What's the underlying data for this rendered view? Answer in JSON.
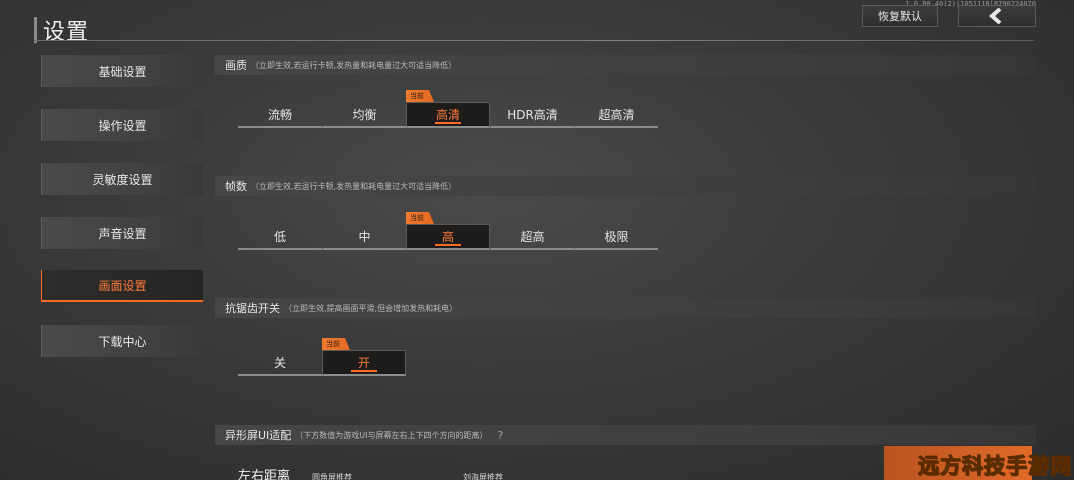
{
  "version": "1.0.80.40(2)|1051118|8790224070",
  "header": {
    "title": "设置",
    "reset_label": "恢复默认",
    "back_icon": "back-arrow-icon"
  },
  "sidebar": {
    "items": [
      {
        "label": "基础设置",
        "active": false
      },
      {
        "label": "操作设置",
        "active": false
      },
      {
        "label": "灵敏度设置",
        "active": false
      },
      {
        "label": "声音设置",
        "active": false
      },
      {
        "label": "画面设置",
        "active": true
      },
      {
        "label": "下载中心",
        "active": false
      }
    ]
  },
  "current_tag": "当前",
  "sections": {
    "quality": {
      "title": "画质",
      "subtitle": "（立即生效,若运行卡顿,发热量和耗电量过大可适当降低）",
      "options": [
        "流畅",
        "均衡",
        "高清",
        "HDR高清",
        "超高清"
      ],
      "selected": "高清"
    },
    "framerate": {
      "title": "帧数",
      "subtitle": "（立即生效,若运行卡顿,发热量和耗电量过大可适当降低）",
      "options": [
        "低",
        "中",
        "高",
        "超高",
        "极限"
      ],
      "selected": "高"
    },
    "antialias": {
      "title": "抗锯齿开关",
      "subtitle": "（立即生效,提高画面平滑,但会增加发热和耗电）",
      "options": [
        "关",
        "开"
      ],
      "selected": "开"
    },
    "notch": {
      "title": "异形屏UI适配",
      "subtitle": "（下方数值为游戏UI与屏幕左右上下四个方向的距离）",
      "help": "?",
      "row_label": "左右距离",
      "sub1": "圆角屏推荐",
      "sub2": "刘海屏推荐"
    }
  },
  "watermark": "远方科技手游网",
  "colors": {
    "accent": "#ff6a28",
    "background": "#3a3a3a"
  }
}
